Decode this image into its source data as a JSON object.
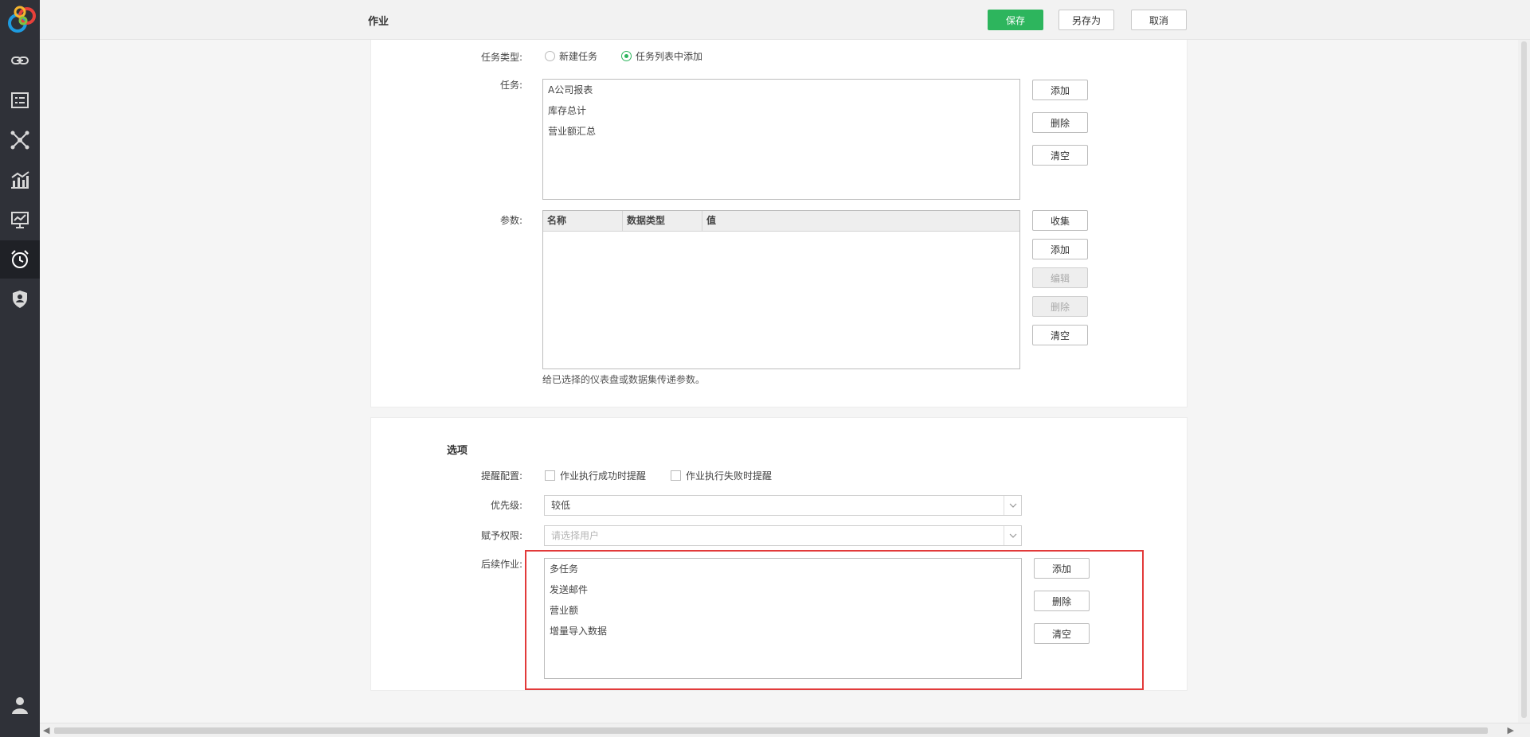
{
  "header": {
    "title": "作业",
    "save_label": "保存",
    "save_as_label": "另存为",
    "cancel_label": "取消"
  },
  "colors": {
    "accent": "#2db55d",
    "highlight": "#e23a3a",
    "sidebar": "#2f3138"
  },
  "sidebar": {
    "items": [
      {
        "icon": "link-icon"
      },
      {
        "icon": "dataset-list-icon"
      },
      {
        "icon": "network-model-icon"
      },
      {
        "icon": "bar-chart-icon"
      },
      {
        "icon": "dashboard-icon"
      },
      {
        "icon": "alarm-clock-icon",
        "active": true
      },
      {
        "icon": "shield-user-icon"
      }
    ],
    "bottom_icon": "user-icon"
  },
  "task_section": {
    "task_type_label": "任务类型:",
    "option_new": "新建任务",
    "option_from_list": "任务列表中添加",
    "selected": "任务列表中添加",
    "tasks_label": "任务:",
    "tasks": [
      "A公司报表",
      "库存总计",
      "营业额汇总"
    ],
    "tasks_buttons": {
      "add": "添加",
      "delete": "删除",
      "clear": "清空"
    },
    "params_label": "参数:",
    "params_columns": [
      "名称",
      "数据类型",
      "值"
    ],
    "params_buttons": {
      "collect": "收集",
      "add": "添加",
      "edit": "编辑",
      "delete": "删除",
      "clear": "清空"
    },
    "params_hint": "给已选择的仪表盘或数据集传递参数。"
  },
  "options_section": {
    "title": "选项",
    "reminder_label": "提醒配置:",
    "reminder_success": "作业执行成功时提醒",
    "reminder_failure": "作业执行失败时提醒",
    "priority_label": "优先级:",
    "priority_value": "较低",
    "permission_label": "赋予权限:",
    "permission_placeholder": "请选择用户",
    "followup_label": "后续作业:",
    "followup_jobs": [
      "多任务",
      "发送邮件",
      "营业额",
      "增量导入数据"
    ],
    "followup_buttons": {
      "add": "添加",
      "delete": "删除",
      "clear": "清空"
    }
  }
}
